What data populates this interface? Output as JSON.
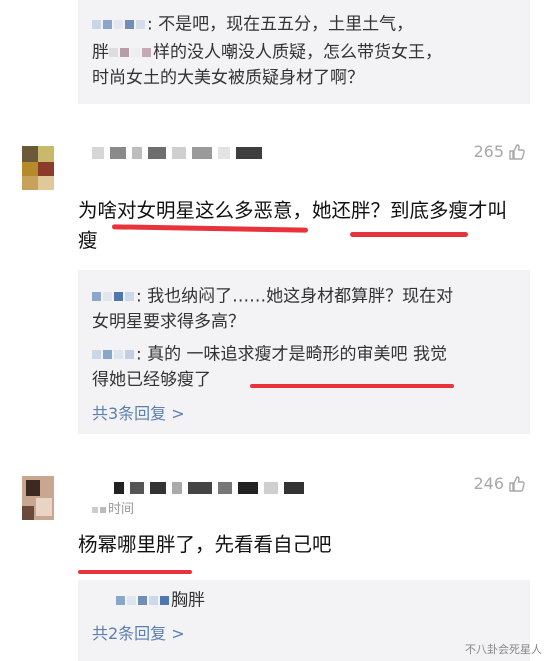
{
  "top_reply": {
    "line1": ": 不是吧，现在五五分，土里土气，",
    "line2_prefix": "胖",
    "line2_suffix": "样的没人嘲没人质疑，怎么带货女王，",
    "line3": "时尚女土的大美女被质疑身材了啊？"
  },
  "comment1": {
    "likes": "265",
    "text_line1": "为啥对女明星这么多恶意，她还胖？到底多瘦才叫",
    "text_line2": "瘦",
    "replies": [
      {
        "line1": ": 我也纳闷了……她这身材都算胖？现在对",
        "line2": "女明星要求得多高？"
      },
      {
        "line1": ": 真的 一味追求瘦才是畸形的审美吧 我觉",
        "line2": "得她已经够瘦了"
      }
    ],
    "more_replies": "共3条回复 >"
  },
  "comment2": {
    "likes": "246",
    "time_fragment": "时间",
    "text": "杨幂哪里胖了，先看看自己吧",
    "reply_preview": "胸胖",
    "more_replies": "共2条回复 >"
  },
  "watermark": "不八卦会死星人",
  "colors": {
    "underline": "#e8323c",
    "link": "#5b7fb0",
    "reply_bg": "#f3f3f5"
  },
  "icons": {
    "like": "thumbs-up-icon"
  }
}
